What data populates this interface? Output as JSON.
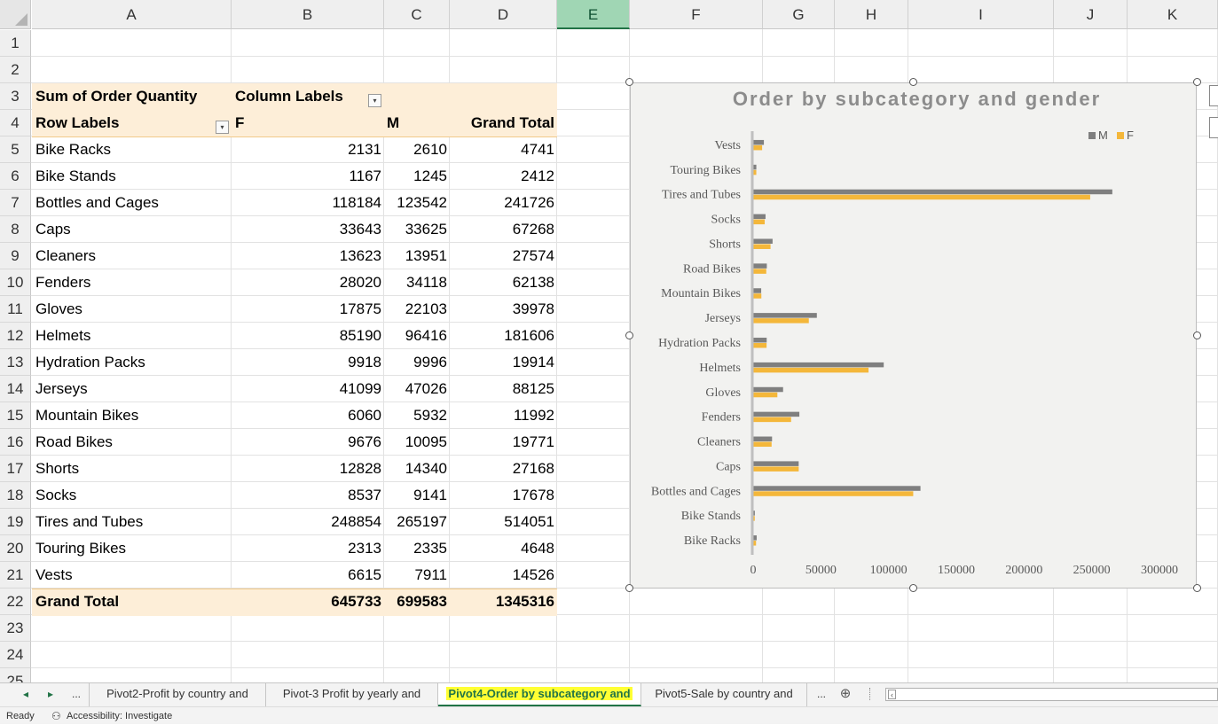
{
  "columns": [
    "A",
    "B",
    "C",
    "D",
    "E",
    "F",
    "G",
    "H",
    "I",
    "J",
    "K"
  ],
  "selected_column": "E",
  "rows": [
    "1",
    "2",
    "3",
    "4",
    "5",
    "6",
    "7",
    "8",
    "9",
    "10",
    "11",
    "12",
    "13",
    "14",
    "15",
    "16",
    "17",
    "18",
    "19",
    "20",
    "21",
    "22",
    "23",
    "24",
    "25"
  ],
  "pivot": {
    "value_header": "Sum of Order Quantity",
    "column_labels": "Column Labels",
    "row_labels": "Row Labels",
    "col_f": "F",
    "col_m": "M",
    "grand_total_label": "Grand Total",
    "items": [
      {
        "label": "Bike Racks",
        "f": "2131",
        "m": "2610",
        "total": "4741"
      },
      {
        "label": "Bike Stands",
        "f": "1167",
        "m": "1245",
        "total": "2412"
      },
      {
        "label": "Bottles and Cages",
        "f": "118184",
        "m": "123542",
        "total": "241726"
      },
      {
        "label": "Caps",
        "f": "33643",
        "m": "33625",
        "total": "67268"
      },
      {
        "label": "Cleaners",
        "f": "13623",
        "m": "13951",
        "total": "27574"
      },
      {
        "label": "Fenders",
        "f": "28020",
        "m": "34118",
        "total": "62138"
      },
      {
        "label": "Gloves",
        "f": "17875",
        "m": "22103",
        "total": "39978"
      },
      {
        "label": "Helmets",
        "f": "85190",
        "m": "96416",
        "total": "181606"
      },
      {
        "label": "Hydration Packs",
        "f": "9918",
        "m": "9996",
        "total": "19914"
      },
      {
        "label": "Jerseys",
        "f": "41099",
        "m": "47026",
        "total": "88125"
      },
      {
        "label": "Mountain Bikes",
        "f": "6060",
        "m": "5932",
        "total": "11992"
      },
      {
        "label": "Road Bikes",
        "f": "9676",
        "m": "10095",
        "total": "19771"
      },
      {
        "label": "Shorts",
        "f": "12828",
        "m": "14340",
        "total": "27168"
      },
      {
        "label": "Socks",
        "f": "8537",
        "m": "9141",
        "total": "17678"
      },
      {
        "label": "Tires and Tubes",
        "f": "248854",
        "m": "265197",
        "total": "514051"
      },
      {
        "label": "Touring Bikes",
        "f": "2313",
        "m": "2335",
        "total": "4648"
      },
      {
        "label": "Vests",
        "f": "6615",
        "m": "7911",
        "total": "14526"
      }
    ],
    "grand_total": {
      "f": "645733",
      "m": "699583",
      "total": "1345316"
    }
  },
  "chart_data": {
    "type": "bar",
    "orientation": "horizontal",
    "title": "Order by subcategory and gender",
    "categories": [
      "Bike Racks",
      "Bike Stands",
      "Bottles and Cages",
      "Caps",
      "Cleaners",
      "Fenders",
      "Gloves",
      "Helmets",
      "Hydration Packs",
      "Jerseys",
      "Mountain Bikes",
      "Road Bikes",
      "Shorts",
      "Socks",
      "Tires and Tubes",
      "Touring Bikes",
      "Vests"
    ],
    "series": [
      {
        "name": "M",
        "color": "#7f7f7f",
        "values": [
          2610,
          1245,
          123542,
          33625,
          13951,
          34118,
          22103,
          96416,
          9996,
          47026,
          5932,
          10095,
          14340,
          9141,
          265197,
          2335,
          7911
        ]
      },
      {
        "name": "F",
        "color": "#f4b73a",
        "values": [
          2131,
          1167,
          118184,
          33643,
          13623,
          28020,
          17875,
          85190,
          9918,
          41099,
          6060,
          9676,
          12828,
          8537,
          248854,
          2313,
          6615
        ]
      }
    ],
    "xlim": [
      0,
      300000
    ],
    "xticks": [
      "0",
      "50000",
      "100000",
      "150000",
      "200000",
      "250000",
      "300000"
    ],
    "legend_position": "top-right"
  },
  "tabs": {
    "items": [
      "Pivot2-Profit by country and",
      "Pivot-3 Profit by yearly and",
      "Pivot4-Order by subcategory and",
      "Pivot5-Sale by country and"
    ],
    "active": "Pivot4-Order by subcategory and",
    "prev": "◂",
    "next": "▸",
    "more": "...",
    "more2": "...",
    "add": "⊕"
  },
  "status": {
    "ready": "Ready",
    "accessibility": "Accessibility: Investigate"
  }
}
